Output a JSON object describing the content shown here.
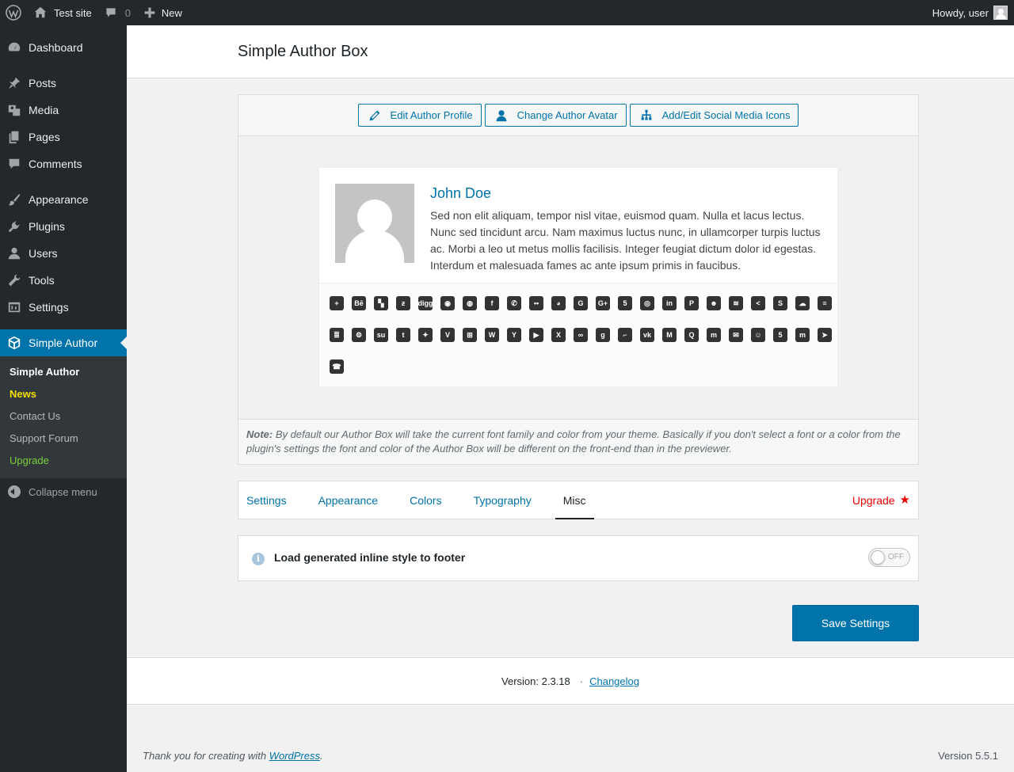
{
  "adminbar": {
    "site_name": "Test site",
    "comments_count": "0",
    "new_label": "New",
    "howdy": "Howdy, user"
  },
  "sidebar": {
    "items": [
      {
        "label": "Dashboard",
        "icon": "dashboard-icon"
      },
      {
        "label": "Posts",
        "icon": "pin-icon"
      },
      {
        "label": "Media",
        "icon": "media-icon"
      },
      {
        "label": "Pages",
        "icon": "pages-icon"
      },
      {
        "label": "Comments",
        "icon": "comment-icon"
      },
      {
        "label": "Appearance",
        "icon": "brush-icon"
      },
      {
        "label": "Plugins",
        "icon": "plug-icon"
      },
      {
        "label": "Users",
        "icon": "user-icon"
      },
      {
        "label": "Tools",
        "icon": "wrench-icon"
      },
      {
        "label": "Settings",
        "icon": "settings-icon"
      },
      {
        "label": "Simple Author",
        "icon": "cube-icon"
      }
    ],
    "submenu": [
      "Simple Author",
      "News",
      "Contact Us",
      "Support Forum",
      "Upgrade"
    ],
    "upgrade_glyph": "",
    "collapse_label": "Collapse menu"
  },
  "page": {
    "title": "Simple Author Box"
  },
  "preview": {
    "buttons": [
      "Edit Author Profile",
      "Change Author Avatar",
      "Add/Edit Social Media Icons"
    ],
    "author_name": "John Doe",
    "author_desc": "Sed non elit aliquam, tempor nisl vitae, euismod quam. Nulla et lacus lectus. Nunc sed tincidunt arcu. Nam maximus luctus nunc, in ullamcorper turpis luctus ac. Morbi a leo ut metus mollis facilisis. Integer feugiat dictum dolor id egestas. Interdum et malesuada fames ac ante ipsum primis in faucibus.",
    "social_icons": [
      {
        "name": "addthis-icon",
        "glyph": "+"
      },
      {
        "name": "behance-icon",
        "glyph": "Bē"
      },
      {
        "name": "delicious-icon",
        "glyph": "▚"
      },
      {
        "name": "deviantart-icon",
        "glyph": "ƶ"
      },
      {
        "name": "digg-icon",
        "glyph": "digg"
      },
      {
        "name": "discord-icon",
        "glyph": "◉"
      },
      {
        "name": "dribbble-icon",
        "glyph": "◍"
      },
      {
        "name": "facebook-icon",
        "glyph": "f"
      },
      {
        "name": "whatsapp-icon",
        "glyph": "✆"
      },
      {
        "name": "flickr-icon",
        "glyph": "••"
      },
      {
        "name": "github-icon",
        "glyph": "◕"
      },
      {
        "name": "google-icon",
        "glyph": "G"
      },
      {
        "name": "googleplus-icon",
        "glyph": "G+"
      },
      {
        "name": "html5-icon",
        "glyph": "5"
      },
      {
        "name": "instagram-icon",
        "glyph": "◎"
      },
      {
        "name": "linkedin-icon",
        "glyph": "in"
      },
      {
        "name": "pinterest-icon",
        "glyph": "P"
      },
      {
        "name": "reddit-icon",
        "glyph": "☻"
      },
      {
        "name": "rss-icon",
        "glyph": "≋"
      },
      {
        "name": "share-icon",
        "glyph": "<"
      },
      {
        "name": "skype-icon",
        "glyph": "S"
      },
      {
        "name": "soundcloud-icon",
        "glyph": "☁"
      },
      {
        "name": "spotify-icon",
        "glyph": "≡"
      },
      {
        "name": "stackoverflow-icon",
        "glyph": "≣"
      },
      {
        "name": "steam-icon",
        "glyph": "⚙"
      },
      {
        "name": "stumbleupon-icon",
        "glyph": "su"
      },
      {
        "name": "tumblr-icon",
        "glyph": "t"
      },
      {
        "name": "twitter-icon",
        "glyph": "✦"
      },
      {
        "name": "vimeo-icon",
        "glyph": "V"
      },
      {
        "name": "windows-icon",
        "glyph": "⊞"
      },
      {
        "name": "wordpress-icon",
        "glyph": "W"
      },
      {
        "name": "yahoo-icon",
        "glyph": "Y"
      },
      {
        "name": "youtube-icon",
        "glyph": "▶"
      },
      {
        "name": "xing-icon",
        "glyph": "X"
      },
      {
        "name": "mixcloud-icon",
        "glyph": "∞"
      },
      {
        "name": "goodreads-icon",
        "glyph": "g"
      },
      {
        "name": "twitch-icon",
        "glyph": "⌐"
      },
      {
        "name": "vk-icon",
        "glyph": "vk"
      },
      {
        "name": "medium-icon",
        "glyph": "M"
      },
      {
        "name": "quora-icon",
        "glyph": "Q"
      },
      {
        "name": "meetup-icon",
        "glyph": "m"
      },
      {
        "name": "email-icon",
        "glyph": "✉"
      },
      {
        "name": "snapchat-icon",
        "glyph": "☺"
      },
      {
        "name": "500px-icon",
        "glyph": "5"
      },
      {
        "name": "mastodon-icon",
        "glyph": "m"
      },
      {
        "name": "telegram-icon",
        "glyph": "➤"
      },
      {
        "name": "phone-icon",
        "glyph": "☎"
      }
    ],
    "note_label": "Note:",
    "note_text": " By default our Author Box will take the current font family and color from your theme. Basically if you don't select a font or a color from the plugin's settings the font and color of the Author Box will be different on the front-end than in the previewer."
  },
  "tabs": [
    "Settings",
    "Appearance",
    "Colors",
    "Typography",
    "Misc"
  ],
  "active_tab": "Misc",
  "upgrade_label": "Upgrade",
  "option": {
    "label": "Load generated inline style to footer",
    "toggle_text": "OFF"
  },
  "save_label": "Save Settings",
  "version": {
    "text": "Version: 2.3.18",
    "separator": "·",
    "changelog": "Changelog"
  },
  "footer": {
    "thanks_prefix": "Thank you for creating with ",
    "thanks_link": "WordPress",
    "thanks_suffix": ".",
    "wp_version": "Version 5.5.1"
  },
  "colors": {
    "accent": "#0073aa",
    "adminbar": "#23282d",
    "news": "#f2e000",
    "upgrade": "#7ad03a",
    "upgrade_tab": "#e00000"
  }
}
